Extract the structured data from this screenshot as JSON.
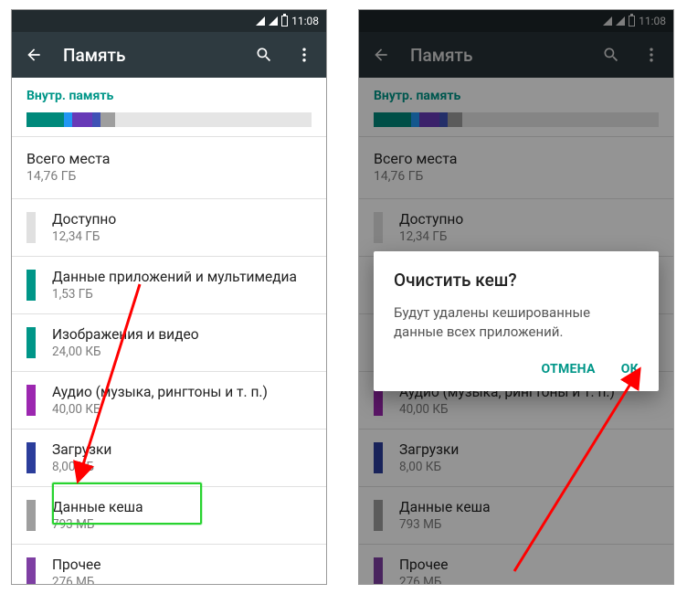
{
  "status": {
    "time": "11:08"
  },
  "appbar": {
    "title": "Память"
  },
  "section_header": "Внутр. память",
  "total": {
    "label": "Всего места",
    "value": "14,76 ГБ"
  },
  "segments": [
    {
      "color": "#00897b",
      "pct": 13
    },
    {
      "color": "#2196f3",
      "pct": 3
    },
    {
      "color": "#673ab7",
      "pct": 7
    },
    {
      "color": "#3f51b5",
      "pct": 3
    },
    {
      "color": "#9e9e9e",
      "pct": 5
    }
  ],
  "rows": [
    {
      "name": "Доступно",
      "size": "12,34 ГБ",
      "color": "#e0e0e0"
    },
    {
      "name": "Данные приложений и мультимедиа",
      "size": "1,53 ГБ",
      "color": "#009688"
    },
    {
      "name": "Изображения и видео",
      "size": "24,00 КБ",
      "color": "#009688"
    },
    {
      "name": "Аудио (музыка, рингтоны и т. п.)",
      "size": "40,00 КБ",
      "color": "#9c27b0"
    },
    {
      "name": "Загрузки",
      "size": "8,00 КБ",
      "color": "#2b3d9b"
    },
    {
      "name": "Данные кеша",
      "size": "793 МБ",
      "color": "#9e9e9e"
    },
    {
      "name": "Прочее",
      "size": "276 МБ",
      "color": "#7e3fa3"
    }
  ],
  "dialog": {
    "title": "Очистить кеш?",
    "body": "Будут удалены кешированные данные всех приложений.",
    "cancel": "ОТМЕНА",
    "ok": "ОК"
  }
}
